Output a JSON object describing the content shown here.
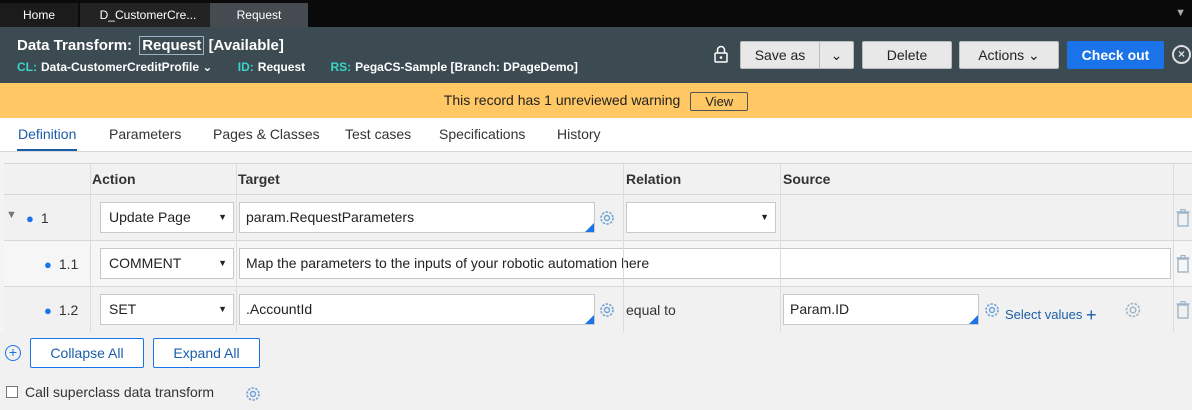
{
  "colors": {
    "accent": "#1a73e8",
    "header_bg": "#3c4a52",
    "warning_bg": "#ffc865",
    "meta_label": "#38d6c9"
  },
  "tabs": [
    {
      "label": "Home"
    },
    {
      "label": "D_CustomerCre..."
    },
    {
      "label": "Request"
    }
  ],
  "header": {
    "type_label": "Data Transform:",
    "record_name": "Request",
    "status": "[Available]",
    "cl_label": "CL:",
    "cl_value": "Data-CustomerCreditProfile",
    "id_label": "ID:",
    "id_value": "Request",
    "rs_label": "RS:",
    "rs_value": "PegaCS-Sample [Branch: DPageDemo]"
  },
  "toolbar": {
    "save_as": "Save as",
    "delete": "Delete",
    "actions": "Actions",
    "check_out": "Check out"
  },
  "warning": {
    "text": "This record has 1 unreviewed warning",
    "view": "View"
  },
  "subtabs": [
    "Definition",
    "Parameters",
    "Pages & Classes",
    "Test cases",
    "Specifications",
    "History"
  ],
  "grid": {
    "headers": {
      "action": "Action",
      "target": "Target",
      "relation": "Relation",
      "source": "Source"
    },
    "rows": [
      {
        "num": "1",
        "action": "Update Page",
        "target": "param.RequestParameters",
        "relation": "",
        "source": ""
      },
      {
        "num": "1.1",
        "action": "COMMENT",
        "comment": "Map the parameters to the inputs of your robotic automation here"
      },
      {
        "num": "1.2",
        "action": "SET",
        "target": ".AccountId",
        "relation": "equal to",
        "source": "Param.ID",
        "select_values": "Select values"
      }
    ]
  },
  "buttons": {
    "collapse_all": "Collapse All",
    "expand_all": "Expand All"
  },
  "superclass": {
    "label": "Call superclass data transform"
  }
}
